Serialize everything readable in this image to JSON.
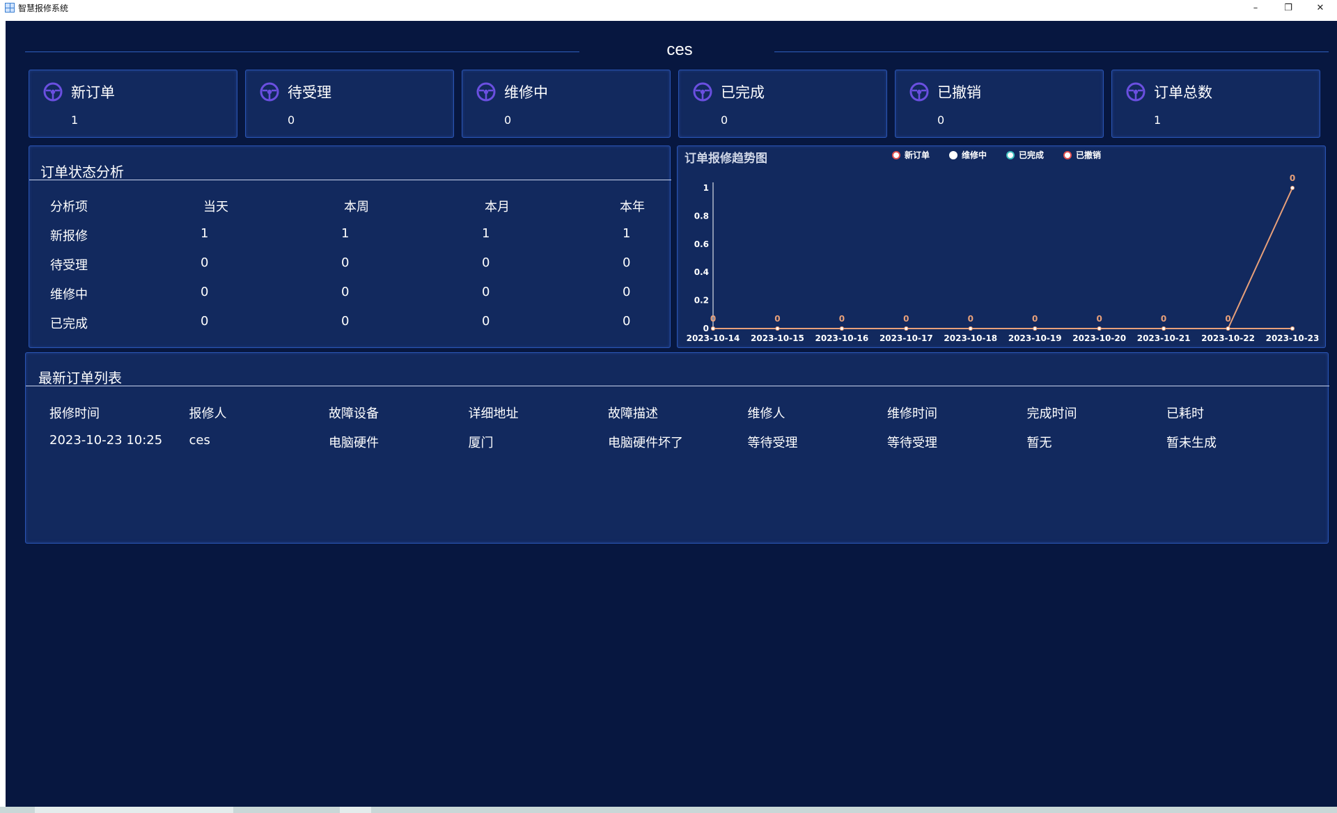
{
  "window": {
    "title": "智慧报修系统",
    "controls": {
      "minimize": "–",
      "maximize": "❐",
      "close": "✕"
    }
  },
  "header": {
    "title": "ces"
  },
  "stats": [
    {
      "label": "新订单",
      "value": "1",
      "icon": "steering-wheel-icon"
    },
    {
      "label": "待受理",
      "value": "0",
      "icon": "steering-wheel-icon"
    },
    {
      "label": "维修中",
      "value": "0",
      "icon": "steering-wheel-icon"
    },
    {
      "label": "已完成",
      "value": "0",
      "icon": "steering-wheel-icon"
    },
    {
      "label": "已撤销",
      "value": "0",
      "icon": "steering-wheel-icon"
    },
    {
      "label": "订单总数",
      "value": "1",
      "icon": "steering-wheel-icon"
    }
  ],
  "analysis": {
    "title": "订单状态分析",
    "columns": [
      "分析项",
      "当天",
      "本周",
      "本月",
      "本年"
    ],
    "rows": [
      [
        "新报修",
        "1",
        "1",
        "1",
        "1"
      ],
      [
        "待受理",
        "0",
        "0",
        "0",
        "0"
      ],
      [
        "维修中",
        "0",
        "0",
        "0",
        "0"
      ],
      [
        "已完成",
        "0",
        "0",
        "0",
        "0"
      ]
    ]
  },
  "chart_data": {
    "type": "line",
    "title": "订单报修趋势图",
    "legend": [
      "新订单",
      "维修中",
      "已完成",
      "已撤销"
    ],
    "legend_position": "top",
    "x": [
      "2023-10-14",
      "2023-10-15",
      "2023-10-16",
      "2023-10-17",
      "2023-10-18",
      "2023-10-19",
      "2023-10-20",
      "2023-10-21",
      "2023-10-22",
      "2023-10-23"
    ],
    "y_ticks": [
      "0",
      "0.2",
      "0.4",
      "0.6",
      "0.8",
      "1"
    ],
    "ylim": [
      0,
      1
    ],
    "grid": false,
    "series": [
      {
        "name": "新订单",
        "values": [
          0,
          0,
          0,
          0,
          0,
          0,
          0,
          0,
          0,
          1
        ],
        "color": "#e8a07a"
      },
      {
        "name": "维修中",
        "values": [
          0,
          0,
          0,
          0,
          0,
          0,
          0,
          0,
          0,
          0
        ],
        "color": "#e8a07a"
      },
      {
        "name": "已完成",
        "values": [
          0,
          0,
          0,
          0,
          0,
          0,
          0,
          0,
          0,
          0
        ],
        "color": "#e8a07a"
      },
      {
        "name": "已撤销",
        "values": [
          0,
          0,
          0,
          0,
          0,
          0,
          0,
          0,
          0,
          0
        ],
        "color": "#e8a07a"
      }
    ],
    "data_labels": [
      "0",
      "0",
      "0",
      "0",
      "0",
      "0",
      "0",
      "0",
      "0",
      "0"
    ]
  },
  "orders": {
    "title": "最新订单列表",
    "columns": [
      "报修时间",
      "报修人",
      "故障设备",
      "详细地址",
      "故障描述",
      "维修人",
      "维修时间",
      "完成时间",
      "已耗时"
    ],
    "rows": [
      [
        "2023-10-23 10:25",
        "ces",
        "电脑硬件",
        "厦门",
        "电脑硬件坏了",
        "等待受理",
        "等待受理",
        "暂无",
        "暂未生成"
      ]
    ]
  },
  "colors": {
    "background": "#071740",
    "panel": "#12295e",
    "border": "#2a55b5",
    "icon": "#6a4fe0",
    "line": "#e8a07a"
  }
}
